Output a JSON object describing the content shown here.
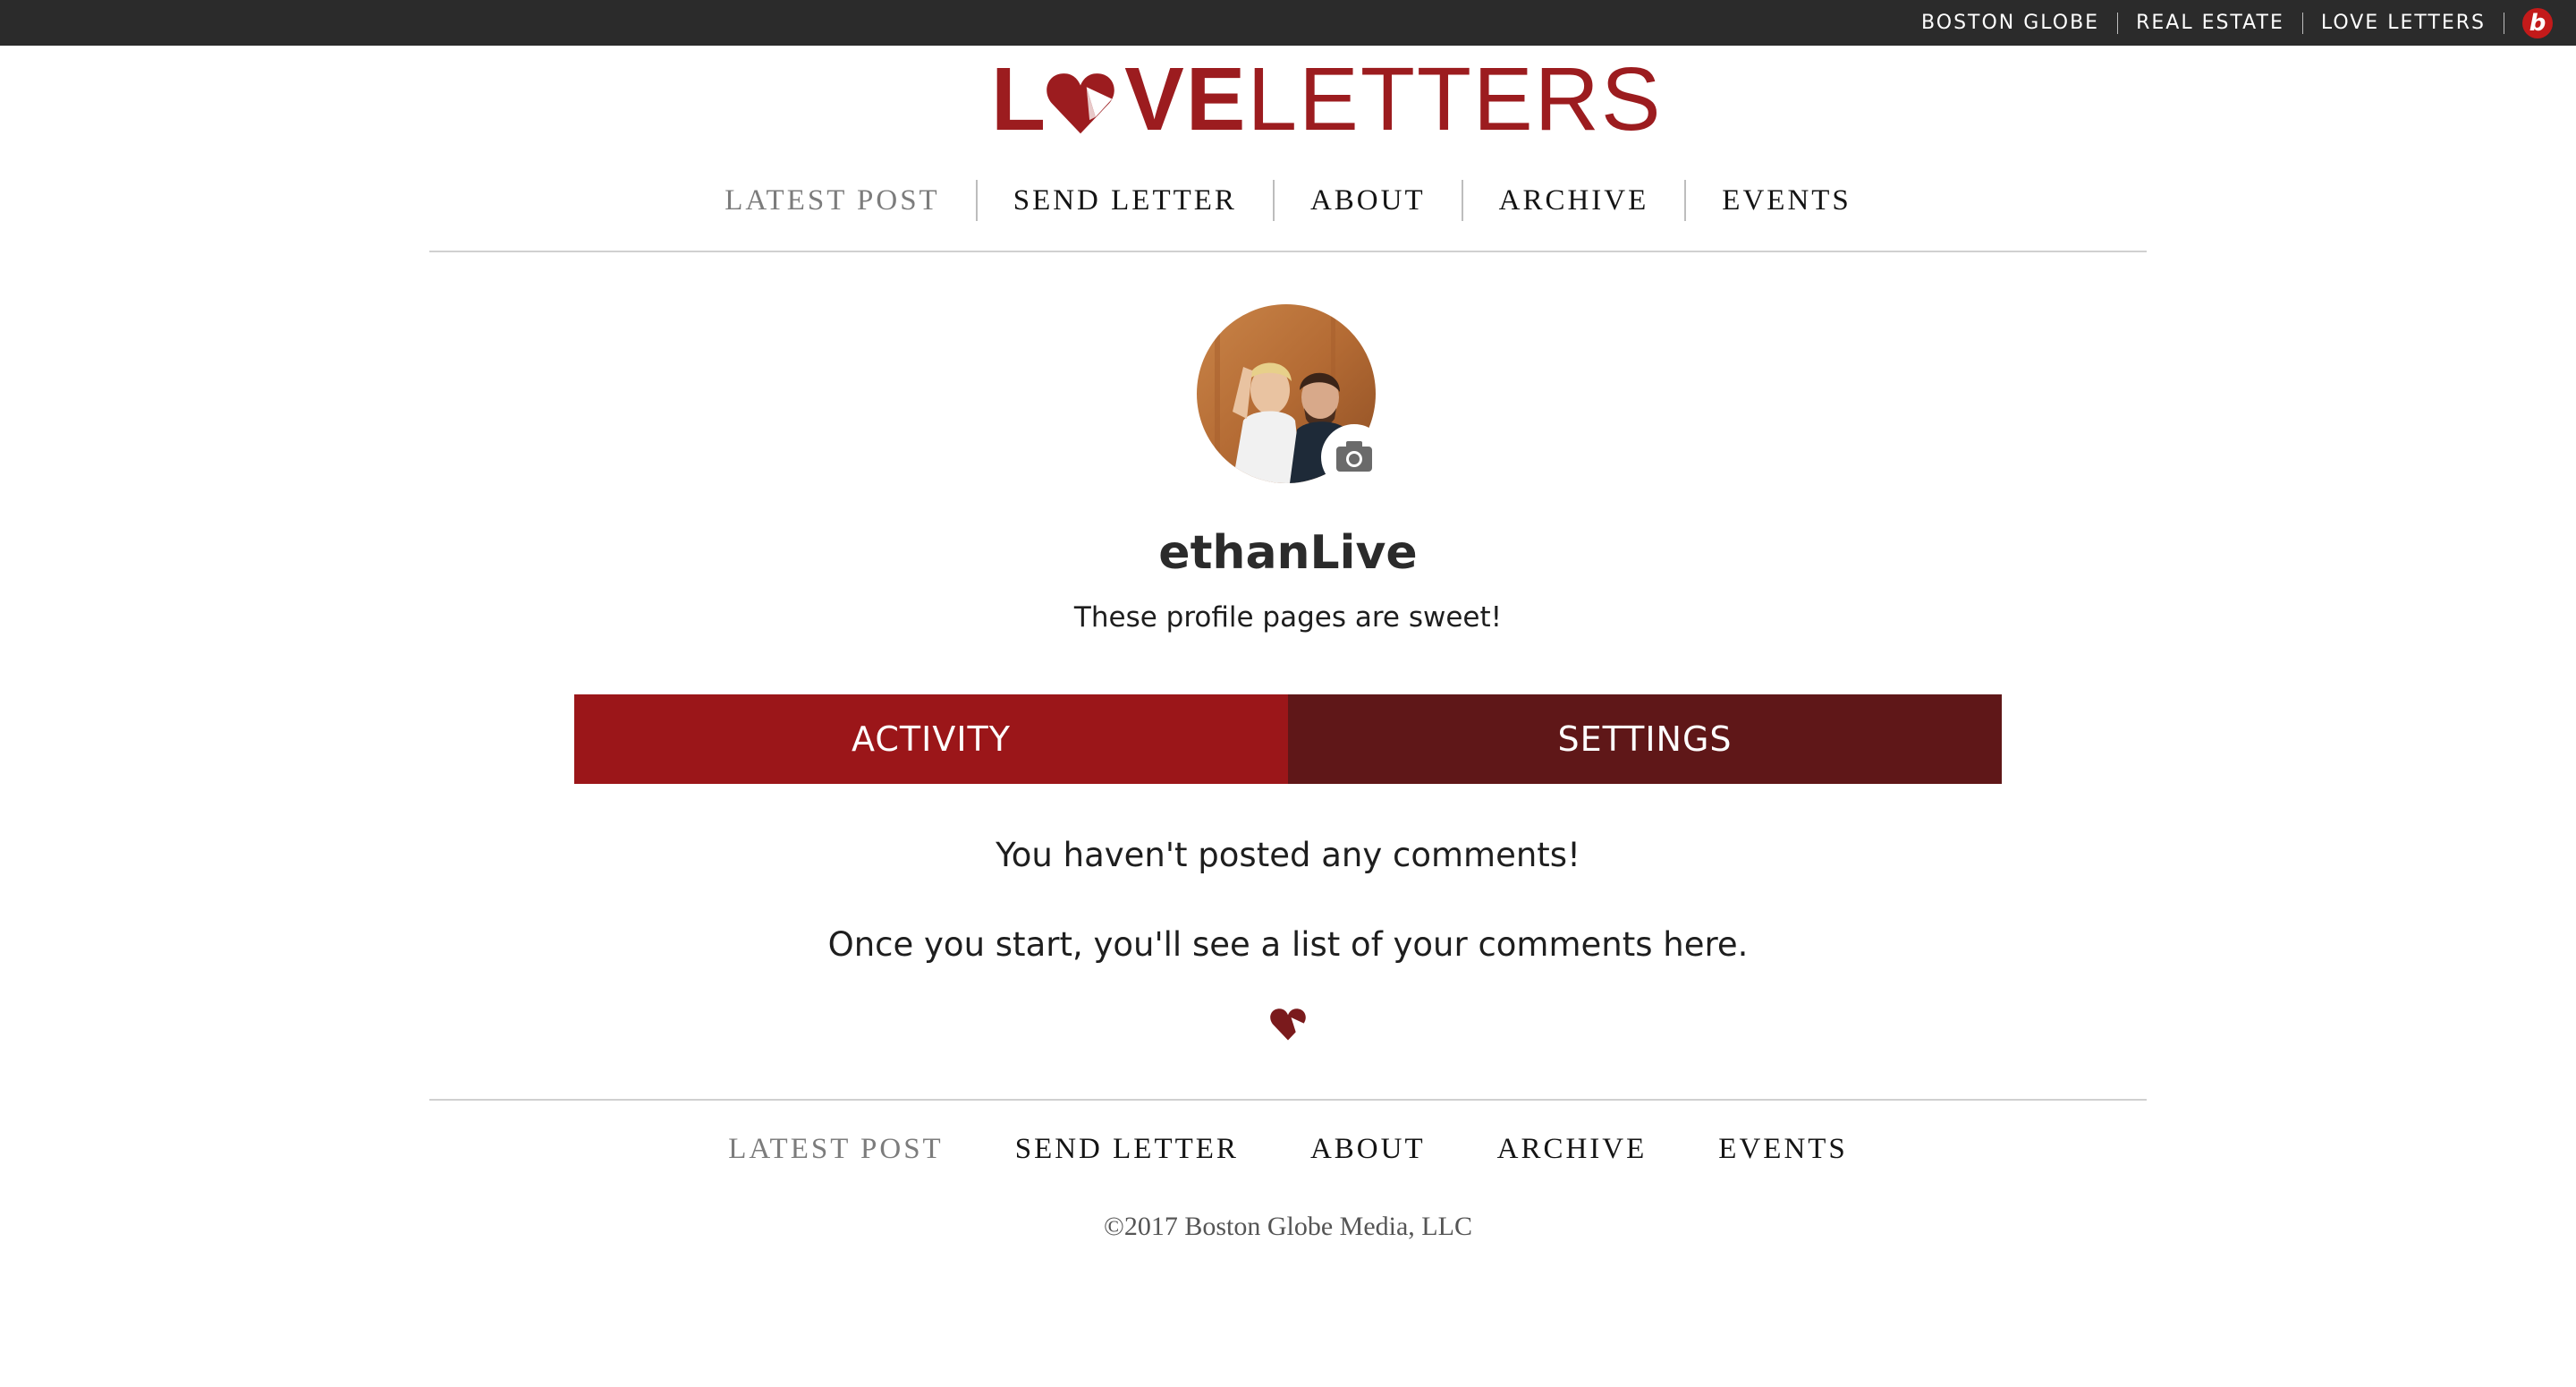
{
  "colors": {
    "brand_red": "#9c1c1f",
    "tab_active": "#9b1619",
    "tab_inactive": "#5f1718",
    "topbar_bg": "#2b2b2b"
  },
  "topbar": {
    "links": [
      "BOSTON GLOBE",
      "REAL ESTATE",
      "LOVE LETTERS"
    ],
    "badge_letter": "b",
    "badge_icon": "boston-dot-com-icon"
  },
  "logo": {
    "part_bold_1": "L",
    "part_bold_2": "VE",
    "part_light": "LETTERS",
    "icon": "heart-icon"
  },
  "nav": {
    "latest_post": "LATEST POST",
    "send_letter": "SEND LETTER",
    "about": "ABOUT",
    "archive": "ARCHIVE",
    "events": "EVENTS",
    "active": "latest_post"
  },
  "profile": {
    "username": "ethanLive",
    "bio": "These profile pages are sweet!",
    "avatar_icon": "avatar-photo",
    "camera_icon": "camera-icon"
  },
  "tabs": {
    "activity": "ACTIVITY",
    "settings": "SETTINGS",
    "selected": "activity"
  },
  "empty_state": {
    "line1": "You haven't posted any comments!",
    "line2": "Once you start, you'll see a list of your comments here.",
    "icon": "heart-icon"
  },
  "footer": {
    "nav": {
      "latest_post": "LATEST POST",
      "send_letter": "SEND LETTER",
      "about": "ABOUT",
      "archive": "ARCHIVE",
      "events": "EVENTS"
    },
    "copyright": "©2017 Boston Globe Media, LLC"
  }
}
